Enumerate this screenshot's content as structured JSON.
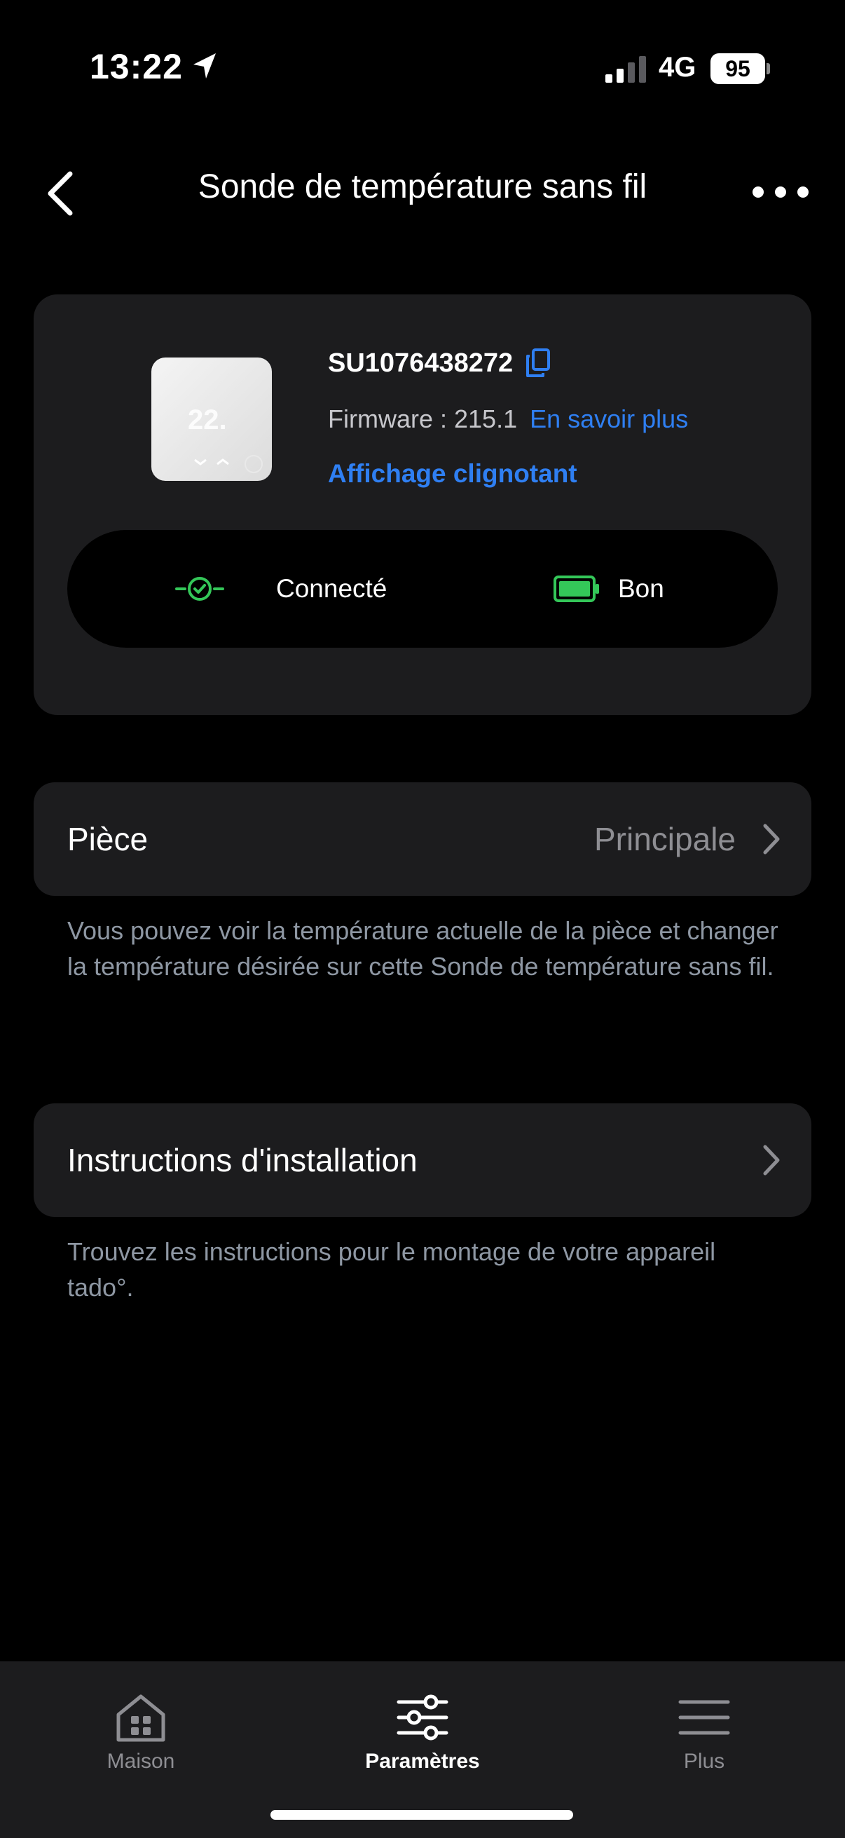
{
  "status_bar": {
    "time": "13:22",
    "network": "4G",
    "battery_level": "95",
    "icons": [
      "location-arrow-icon",
      "signal-icon",
      "battery-icon"
    ]
  },
  "header": {
    "title": "Sonde de température sans fil",
    "back_icon": "chevron-left-icon",
    "more_icon": "more-horizontal-icon"
  },
  "device": {
    "serial": "SU1076438272",
    "firmware_label": "Firmware : 215.1",
    "firmware_link": "En savoir plus",
    "identify_link": "Affichage clignotant",
    "connection_status": "Connecté",
    "battery_status": "Bon",
    "image_icon": "temperature-sensor-device-icon"
  },
  "colors": {
    "background": "#000000",
    "card": "#1c1c1e",
    "link": "#2f7ff2",
    "success": "#34c759",
    "secondary_text": "#8e8e93"
  },
  "room": {
    "label": "Pièce",
    "value": "Principale",
    "helper": "Vous pouvez voir la température actuelle de la pièce et changer la température désirée sur cette Sonde de température sans fil."
  },
  "installation": {
    "label": "Instructions d'installation",
    "helper": "Trouvez les instructions pour le montage de votre appareil tado°."
  },
  "tabs": [
    {
      "label": "Maison",
      "icon": "home-icon",
      "active": false
    },
    {
      "label": "Paramètres",
      "icon": "sliders-icon",
      "active": true
    },
    {
      "label": "Plus",
      "icon": "menu-icon",
      "active": false
    }
  ]
}
